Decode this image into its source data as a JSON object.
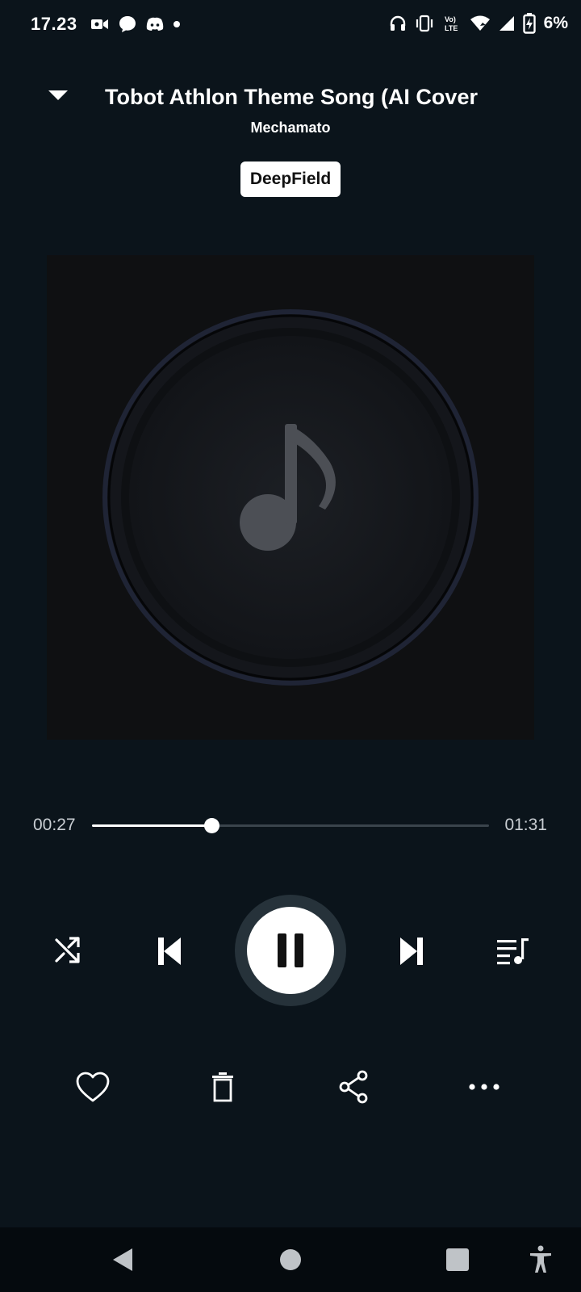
{
  "status_bar": {
    "time": "17.23",
    "battery_text": "6%",
    "left_icons": [
      "video-call-icon",
      "chat-bubble-icon",
      "discord-icon",
      "dot-icon"
    ],
    "right_icons": [
      "headphones-icon",
      "vibrate-icon",
      "volte-icon",
      "wifi-icon",
      "cell-signal-icon",
      "battery-charging-icon"
    ]
  },
  "player": {
    "title": "Tobot Athlon Theme Song (AI Cover",
    "artist": "Mechamato",
    "source_badge": "DeepField",
    "artwork_icon": "music-note-icon",
    "elapsed": "00:27",
    "duration": "01:31",
    "progress_fraction": 0.3,
    "playing": true
  },
  "controls": [
    "shuffle-icon",
    "previous-icon",
    "pause-icon",
    "next-icon",
    "queue-icon"
  ],
  "actions": [
    "heart-icon",
    "trash-icon",
    "share-icon",
    "more-icon"
  ],
  "nav_bar": [
    "back-icon",
    "home-icon",
    "recents-icon",
    "accessibility-icon"
  ],
  "colors": {
    "background": "#0b141b",
    "accent": "#ffffff",
    "track": "#3a444c",
    "play_ring": "#26323a"
  }
}
